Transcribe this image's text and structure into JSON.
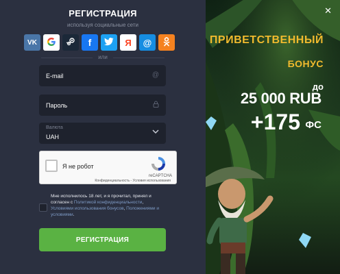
{
  "form": {
    "title": "РЕГИСТРАЦИЯ",
    "subtitle": "используя социальные сети",
    "social": [
      {
        "icon": "vk-icon",
        "color": "#4a76a8",
        "glyph": "VK"
      },
      {
        "icon": "google-icon",
        "color": "#ffffff",
        "glyph": "G"
      },
      {
        "icon": "steam-icon",
        "color": "#1b2838",
        "glyph": "◉"
      },
      {
        "icon": "facebook-icon",
        "color": "#1877f2",
        "glyph": "f"
      },
      {
        "icon": "twitter-icon",
        "color": "#1da1f2",
        "glyph": "🐦"
      },
      {
        "icon": "yandex-icon",
        "color": "#ffffff",
        "glyph": "Я"
      },
      {
        "icon": "mailru-icon",
        "color": "#168de2",
        "glyph": "@"
      },
      {
        "icon": "odnoklassniki-icon",
        "color": "#f58220",
        "glyph": "ОК"
      }
    ],
    "or_label": "или",
    "email_placeholder": "E-mail",
    "password_placeholder": "Пароль",
    "currency_label": "Валюта",
    "currency_value": "UAH",
    "captcha": {
      "label": "Я не робот",
      "brand": "reCAPTCHA",
      "links": "Конфиденциальность - Условия использования"
    },
    "agree": {
      "text1": "Мне исполнилось 18 лет, и я прочитал, принял и согласен с",
      "link1": "Политикой конфиденциальности",
      "sep1": ",",
      "link2": "Условиями использования бонусов",
      "sep2": ",",
      "link3": "Положениями и условиями",
      "end": "."
    },
    "submit_label": "РЕГИСТРАЦИЯ"
  },
  "promo": {
    "title": "ПРИВЕТСТВЕННЫЙ",
    "bonus_word": "БОНУС",
    "up_to": "до",
    "amount": "25 000 RUB",
    "plus": "+175",
    "fs": "ФС"
  },
  "colors": {
    "accent_green": "#5ab243",
    "promo_gold": "#f1ba2e",
    "panel_bg": "#2b3040",
    "field_bg": "#1e222d"
  }
}
